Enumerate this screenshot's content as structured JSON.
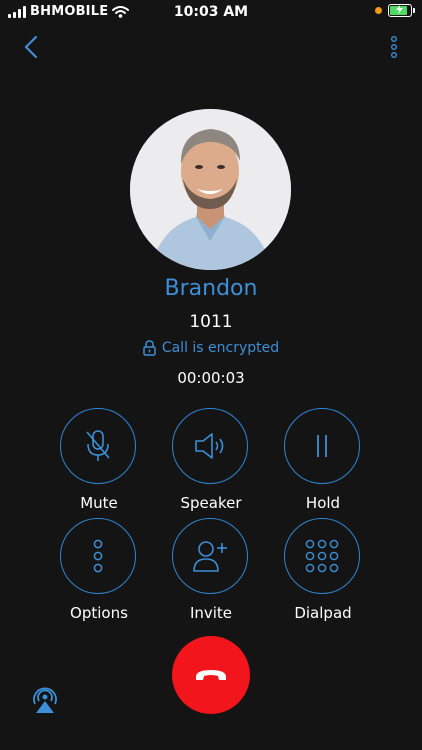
{
  "status_bar": {
    "carrier": "BHMOBILE",
    "time": "10:03 AM"
  },
  "caller": {
    "name": "Brandon",
    "number": "1011",
    "encryption": "Call is encrypted",
    "duration": "00:00:03"
  },
  "actions": [
    {
      "label": "Mute",
      "icon": "mic-off-icon"
    },
    {
      "label": "Speaker",
      "icon": "speaker-icon"
    },
    {
      "label": "Hold",
      "icon": "pause-icon"
    },
    {
      "label": "Options",
      "icon": "vertical-dots-icon"
    },
    {
      "label": "Invite",
      "icon": "add-person-icon"
    },
    {
      "label": "Dialpad",
      "icon": "dialpad-icon"
    }
  ],
  "colors": {
    "accent": "#3d8fd6",
    "background": "#141414",
    "hangup": "#f2151c"
  }
}
